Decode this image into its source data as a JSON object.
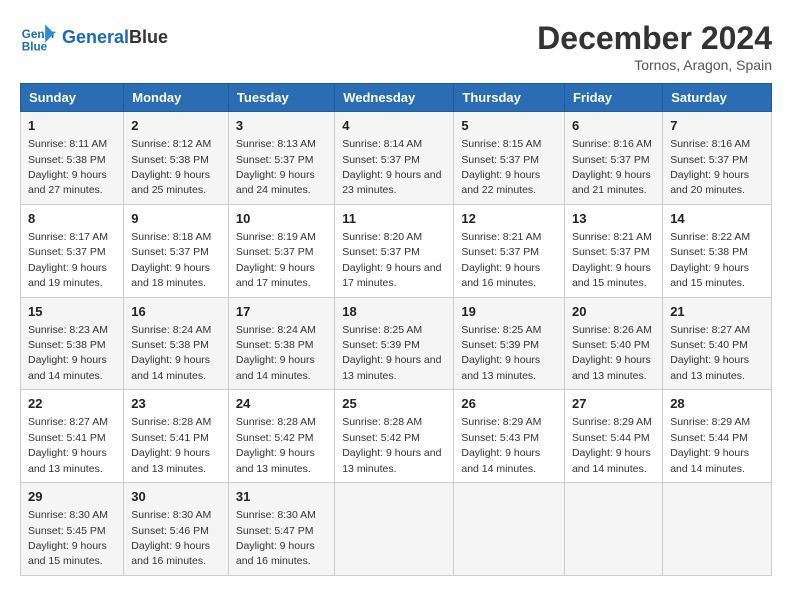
{
  "header": {
    "logo_line1": "General",
    "logo_line2": "Blue",
    "main_title": "December 2024",
    "subtitle": "Tornos, Aragon, Spain"
  },
  "days_of_week": [
    "Sunday",
    "Monday",
    "Tuesday",
    "Wednesday",
    "Thursday",
    "Friday",
    "Saturday"
  ],
  "weeks": [
    [
      {
        "day": "1",
        "sunrise": "8:11 AM",
        "sunset": "5:38 PM",
        "daylight": "9 hours and 27 minutes."
      },
      {
        "day": "2",
        "sunrise": "8:12 AM",
        "sunset": "5:38 PM",
        "daylight": "9 hours and 25 minutes."
      },
      {
        "day": "3",
        "sunrise": "8:13 AM",
        "sunset": "5:37 PM",
        "daylight": "9 hours and 24 minutes."
      },
      {
        "day": "4",
        "sunrise": "8:14 AM",
        "sunset": "5:37 PM",
        "daylight": "9 hours and 23 minutes."
      },
      {
        "day": "5",
        "sunrise": "8:15 AM",
        "sunset": "5:37 PM",
        "daylight": "9 hours and 22 minutes."
      },
      {
        "day": "6",
        "sunrise": "8:16 AM",
        "sunset": "5:37 PM",
        "daylight": "9 hours and 21 minutes."
      },
      {
        "day": "7",
        "sunrise": "8:16 AM",
        "sunset": "5:37 PM",
        "daylight": "9 hours and 20 minutes."
      }
    ],
    [
      {
        "day": "8",
        "sunrise": "8:17 AM",
        "sunset": "5:37 PM",
        "daylight": "9 hours and 19 minutes."
      },
      {
        "day": "9",
        "sunrise": "8:18 AM",
        "sunset": "5:37 PM",
        "daylight": "9 hours and 18 minutes."
      },
      {
        "day": "10",
        "sunrise": "8:19 AM",
        "sunset": "5:37 PM",
        "daylight": "9 hours and 17 minutes."
      },
      {
        "day": "11",
        "sunrise": "8:20 AM",
        "sunset": "5:37 PM",
        "daylight": "9 hours and 17 minutes."
      },
      {
        "day": "12",
        "sunrise": "8:21 AM",
        "sunset": "5:37 PM",
        "daylight": "9 hours and 16 minutes."
      },
      {
        "day": "13",
        "sunrise": "8:21 AM",
        "sunset": "5:37 PM",
        "daylight": "9 hours and 15 minutes."
      },
      {
        "day": "14",
        "sunrise": "8:22 AM",
        "sunset": "5:38 PM",
        "daylight": "9 hours and 15 minutes."
      }
    ],
    [
      {
        "day": "15",
        "sunrise": "8:23 AM",
        "sunset": "5:38 PM",
        "daylight": "9 hours and 14 minutes."
      },
      {
        "day": "16",
        "sunrise": "8:24 AM",
        "sunset": "5:38 PM",
        "daylight": "9 hours and 14 minutes."
      },
      {
        "day": "17",
        "sunrise": "8:24 AM",
        "sunset": "5:38 PM",
        "daylight": "9 hours and 14 minutes."
      },
      {
        "day": "18",
        "sunrise": "8:25 AM",
        "sunset": "5:39 PM",
        "daylight": "9 hours and 13 minutes."
      },
      {
        "day": "19",
        "sunrise": "8:25 AM",
        "sunset": "5:39 PM",
        "daylight": "9 hours and 13 minutes."
      },
      {
        "day": "20",
        "sunrise": "8:26 AM",
        "sunset": "5:40 PM",
        "daylight": "9 hours and 13 minutes."
      },
      {
        "day": "21",
        "sunrise": "8:27 AM",
        "sunset": "5:40 PM",
        "daylight": "9 hours and 13 minutes."
      }
    ],
    [
      {
        "day": "22",
        "sunrise": "8:27 AM",
        "sunset": "5:41 PM",
        "daylight": "9 hours and 13 minutes."
      },
      {
        "day": "23",
        "sunrise": "8:28 AM",
        "sunset": "5:41 PM",
        "daylight": "9 hours and 13 minutes."
      },
      {
        "day": "24",
        "sunrise": "8:28 AM",
        "sunset": "5:42 PM",
        "daylight": "9 hours and 13 minutes."
      },
      {
        "day": "25",
        "sunrise": "8:28 AM",
        "sunset": "5:42 PM",
        "daylight": "9 hours and 13 minutes."
      },
      {
        "day": "26",
        "sunrise": "8:29 AM",
        "sunset": "5:43 PM",
        "daylight": "9 hours and 14 minutes."
      },
      {
        "day": "27",
        "sunrise": "8:29 AM",
        "sunset": "5:44 PM",
        "daylight": "9 hours and 14 minutes."
      },
      {
        "day": "28",
        "sunrise": "8:29 AM",
        "sunset": "5:44 PM",
        "daylight": "9 hours and 14 minutes."
      }
    ],
    [
      {
        "day": "29",
        "sunrise": "8:30 AM",
        "sunset": "5:45 PM",
        "daylight": "9 hours and 15 minutes."
      },
      {
        "day": "30",
        "sunrise": "8:30 AM",
        "sunset": "5:46 PM",
        "daylight": "9 hours and 16 minutes."
      },
      {
        "day": "31",
        "sunrise": "8:30 AM",
        "sunset": "5:47 PM",
        "daylight": "9 hours and 16 minutes."
      },
      null,
      null,
      null,
      null
    ]
  ]
}
